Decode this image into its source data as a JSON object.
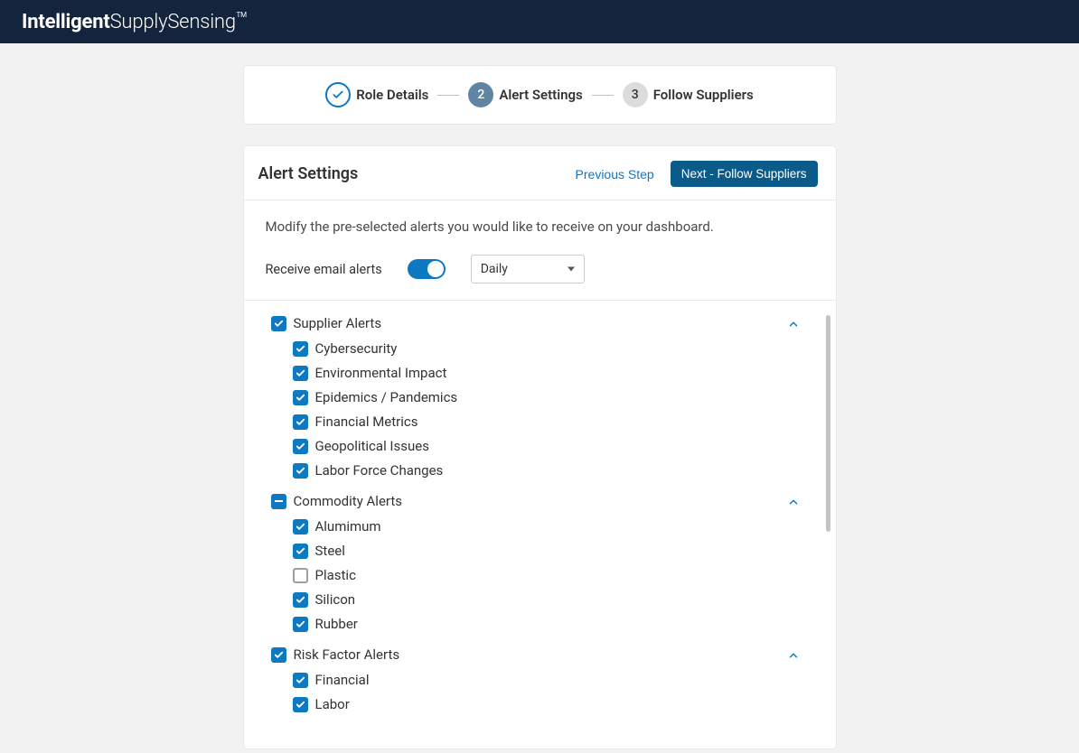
{
  "header": {
    "logo_bold": "Intelligent",
    "logo_light": "SupplySensing",
    "logo_tm": "TM"
  },
  "stepper": {
    "steps": [
      {
        "label": "Role Details",
        "state": "done"
      },
      {
        "label": "Alert Settings",
        "num": "2",
        "state": "active"
      },
      {
        "label": "Follow Suppliers",
        "num": "3",
        "state": "pending"
      }
    ]
  },
  "panel": {
    "title": "Alert Settings",
    "prev_label": "Previous Step",
    "next_label": "Next - Follow Suppliers",
    "description": "Modify the pre-selected alerts you would like to receive on your dashboard.",
    "email_label": "Receive email alerts",
    "email_toggle_on": true,
    "frequency_selected": "Daily"
  },
  "groups": [
    {
      "title": "Supplier Alerts",
      "state": "checked",
      "expanded": true,
      "items": [
        {
          "label": "Cybersecurity",
          "checked": true
        },
        {
          "label": "Environmental Impact",
          "checked": true
        },
        {
          "label": "Epidemics / Pandemics",
          "checked": true
        },
        {
          "label": "Financial Metrics",
          "checked": true
        },
        {
          "label": "Geopolitical Issues",
          "checked": true
        },
        {
          "label": "Labor Force Changes",
          "checked": true
        }
      ]
    },
    {
      "title": "Commodity Alerts",
      "state": "partial",
      "expanded": true,
      "items": [
        {
          "label": "Alumimum",
          "checked": true
        },
        {
          "label": "Steel",
          "checked": true
        },
        {
          "label": "Plastic",
          "checked": false
        },
        {
          "label": "Silicon",
          "checked": true
        },
        {
          "label": "Rubber",
          "checked": true
        }
      ]
    },
    {
      "title": "Risk Factor Alerts",
      "state": "checked",
      "expanded": true,
      "items": [
        {
          "label": "Financial",
          "checked": true
        },
        {
          "label": "Labor",
          "checked": true
        }
      ]
    }
  ],
  "colors": {
    "header_bg": "#13243c",
    "accent": "#0d79c3",
    "primary_btn": "#0a5a8a"
  }
}
